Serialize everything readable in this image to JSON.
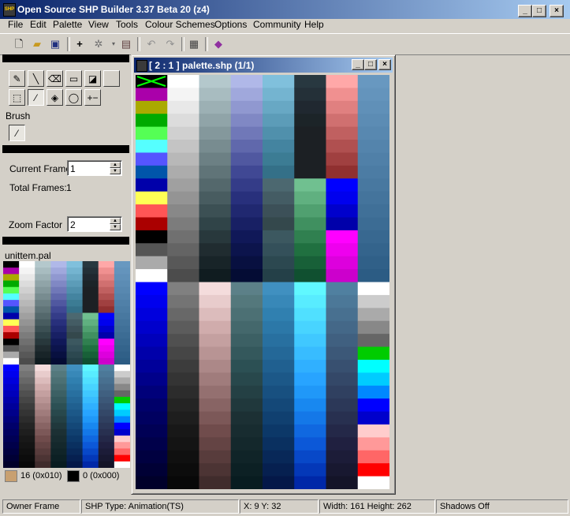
{
  "app": {
    "title": "Open Source SHP Builder 3.37 Beta 20 (z4)"
  },
  "menu": [
    "File",
    "Edit",
    "Palette",
    "View",
    "Tools",
    "Colour Schemes",
    "Options",
    "Community",
    "Help"
  ],
  "toolbar": {
    "icons": [
      "new-file-icon",
      "open-folder-icon",
      "save-icon",
      "crosshair-icon",
      "sparkle-icon",
      "preview-icon",
      "undo-icon",
      "redo-icon",
      "properties-icon",
      "book-icon"
    ]
  },
  "tools": {
    "brush_label": "Brush",
    "current_frame_label": "Current Frame",
    "current_frame_value": "1",
    "total_frames_label": "Total Frames:",
    "total_frames_value": "1",
    "zoom_label": "Zoom Factor",
    "zoom_value": "2",
    "palette_name": "unittem.pal",
    "primary_color": {
      "label": "16 (0x010)",
      "hex": "#c8a070"
    },
    "secondary_color": {
      "label": "0 (0x000)",
      "hex": "#000000"
    }
  },
  "document": {
    "title": "[ 2 : 1 ] palette.shp (1/1)"
  },
  "status": {
    "owner": "Owner Frame",
    "type": "SHP Type: Animation(TS)",
    "coords": "X: 9 Y: 32",
    "size": "Width: 161 Height: 262",
    "shadows": "Shadows Off"
  },
  "colors": {
    "titlebar_start": "#0a246a",
    "titlebar_end": "#a6caf0",
    "face": "#d4d0c8"
  },
  "palette_columns": [
    [
      "#000000",
      "#aa00aa",
      "#aaaa00",
      "#00aa00",
      "#55ff55",
      "#55ffff",
      "#5555ff",
      "#0055aa",
      "#0000aa",
      "#ffff55",
      "#ff5555",
      "#aa0000",
      "#000000",
      "#555555",
      "#aaaaaa",
      "#ffffff",
      "#0000ff",
      "#0000ee",
      "#0000dd",
      "#0000cc",
      "#0000bb",
      "#0000aa",
      "#00009a",
      "#00008a",
      "#00007a",
      "#00006a",
      "#000060",
      "#000055",
      "#00004a",
      "#000040",
      "#000035",
      "#00002a"
    ],
    [
      "#ffffff",
      "#f4f4f4",
      "#e8e8e8",
      "#dcdcdc",
      "#d0d0d0",
      "#c4c4c4",
      "#b8b8b8",
      "#acacac",
      "#a0a0a0",
      "#949494",
      "#888888",
      "#7c7c7c",
      "#707070",
      "#646464",
      "#585858",
      "#4c4c4c",
      "#808080",
      "#747474",
      "#686868",
      "#5c5c5c",
      "#505050",
      "#464646",
      "#3c3c3c",
      "#343434",
      "#2c2c2c",
      "#242424",
      "#1e1e1e",
      "#181818",
      "#141414",
      "#101010",
      "#0c0c0c",
      "#080808"
    ],
    [
      "#b4c8cc",
      "#a8bcc0",
      "#9cb0b4",
      "#90a4a8",
      "#84989c",
      "#788c90",
      "#6c8084",
      "#607478",
      "#54686c",
      "#485c60",
      "#3c5054",
      "#304448",
      "#28383c",
      "#202c30",
      "#182428",
      "#101c20",
      "#f4dcdc",
      "#e8cccc",
      "#dcbcbc",
      "#d0acac",
      "#c4a0a0",
      "#b89494",
      "#ac8888",
      "#a07c7c",
      "#947070",
      "#886464",
      "#7c5858",
      "#704c4c",
      "#644444",
      "#583c3c",
      "#4c3434",
      "#402c2c"
    ],
    [
      "#b0b8e8",
      "#a0a8dc",
      "#9098d0",
      "#8088c4",
      "#7078b8",
      "#6068ac",
      "#5058a0",
      "#404894",
      "#343c88",
      "#28307c",
      "#202870",
      "#182064",
      "#101858",
      "#0c144c",
      "#081040",
      "#040c34",
      "#5c8088",
      "#54787c",
      "#4c7074",
      "#44686c",
      "#3c6064",
      "#34585c",
      "#2c5054",
      "#28484c",
      "#244044",
      "#20383c",
      "#1c3034",
      "#182c30",
      "#14282c",
      "#102428",
      "#0c2024",
      "#081c20"
    ],
    [
      "#80c0dc",
      "#74b4d0",
      "#68a8c4",
      "#5c9cb8",
      "#5090ac",
      "#4484a0",
      "#3c7c94",
      "#347088",
      "#4c6870",
      "#445c64",
      "#3c5058",
      "#34484c",
      "#3c5860",
      "#34505a",
      "#2c4850",
      "#244048",
      "#4090c0",
      "#3888b8",
      "#3080b0",
      "#2c78a8",
      "#2870a0",
      "#246898",
      "#206090",
      "#1c5888",
      "#185080",
      "#144878",
      "#104070",
      "#0c3868",
      "#0a3060",
      "#082858",
      "#062050",
      "#041848"
    ],
    [
      "#283840",
      "#243038",
      "#202830",
      "#1c2428",
      "#1c2024",
      "#1c2024",
      "#1c2024",
      "#1c2024",
      "#70c090",
      "#60b080",
      "#50a070",
      "#409060",
      "#308050",
      "#207040",
      "#186038",
      "#105030",
      "#60f8ff",
      "#58ecff",
      "#50e0ff",
      "#48d4ff",
      "#40c8ff",
      "#38bcff",
      "#30b0ff",
      "#28a4ff",
      "#2098f8",
      "#1888f0",
      "#1478e8",
      "#1068e0",
      "#0c58d8",
      "#0848c8",
      "#0438b8",
      "#0028a8"
    ],
    [
      "#ffa8a8",
      "#f09090",
      "#e08080",
      "#d07070",
      "#c06060",
      "#b05050",
      "#a04040",
      "#903030",
      "#0000ff",
      "#0000ee",
      "#0000cc",
      "#0000aa",
      "#ff00ff",
      "#ee00ee",
      "#dd00dd",
      "#cc00cc",
      "#5080a0",
      "#4c7898",
      "#487090",
      "#446888",
      "#406080",
      "#3c5878",
      "#385070",
      "#344868",
      "#304060",
      "#2c3858",
      "#283050",
      "#242848",
      "#202040",
      "#1c1c38",
      "#181830",
      "#141428"
    ],
    [
      "#6898c0",
      "#6494bc",
      "#6090b8",
      "#5c8cb4",
      "#5888b0",
      "#5484ac",
      "#5080a8",
      "#4c7ca4",
      "#4878a0",
      "#44749c",
      "#407098",
      "#3c6c94",
      "#386890",
      "#34648c",
      "#306088",
      "#2c5c84",
      "#ffffff",
      "#cccccc",
      "#aaaaaa",
      "#888888",
      "#666666",
      "#00cc00",
      "#00ffff",
      "#00ccff",
      "#0088ff",
      "#0000ff",
      "#0000cc",
      "#ffcccc",
      "#ff9999",
      "#ff6666",
      "#ff0000",
      "#ffffff"
    ]
  ]
}
